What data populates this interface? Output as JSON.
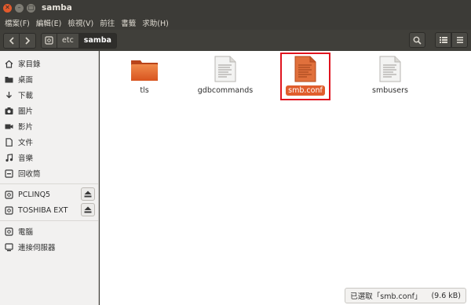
{
  "window": {
    "title": "samba"
  },
  "menubar": [
    "檔案(F)",
    "編輯(E)",
    "檢視(V)",
    "前往",
    "書籤",
    "求助(H)"
  ],
  "path": {
    "segments": [
      "etc",
      "samba"
    ]
  },
  "sidebar": {
    "places": [
      {
        "label": "家目錄",
        "icon": "home-icon"
      },
      {
        "label": "桌面",
        "icon": "folder-icon"
      },
      {
        "label": "下載",
        "icon": "download-icon"
      },
      {
        "label": "圖片",
        "icon": "camera-icon"
      },
      {
        "label": "影片",
        "icon": "video-icon"
      },
      {
        "label": "文件",
        "icon": "document-icon"
      },
      {
        "label": "音樂",
        "icon": "music-icon"
      },
      {
        "label": "回收筒",
        "icon": "trash-icon"
      }
    ],
    "devices": [
      {
        "label": "PCLINQ5",
        "icon": "drive-icon"
      },
      {
        "label": "TOSHIBA EXT",
        "icon": "drive-icon"
      }
    ],
    "network": [
      {
        "label": "電腦",
        "icon": "computer-icon"
      },
      {
        "label": "連接伺服器",
        "icon": "network-server-icon"
      }
    ]
  },
  "files": [
    {
      "name": "tls",
      "type": "folder",
      "selected": false
    },
    {
      "name": "gdbcommands",
      "type": "text",
      "selected": false
    },
    {
      "name": "smb.conf",
      "type": "text",
      "selected": true
    },
    {
      "name": "smbusers",
      "type": "text",
      "selected": false
    }
  ],
  "status": {
    "text": "已選取「smb.conf」",
    "size": "(9.6 kB)"
  },
  "colors": {
    "accent": "#e05d2d",
    "highlight_box": "#e0141f",
    "titlebar": "#3c3b37"
  }
}
